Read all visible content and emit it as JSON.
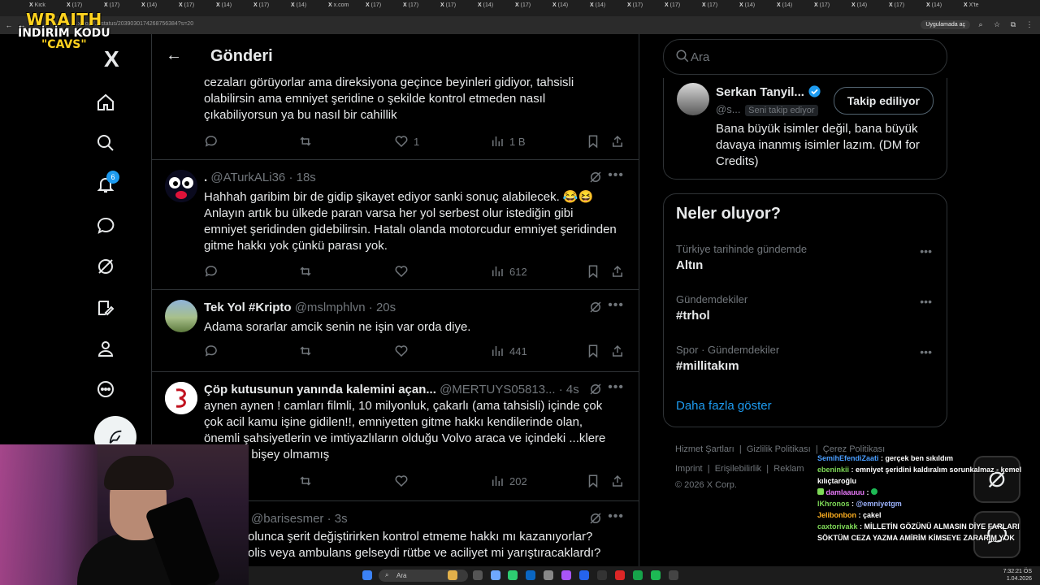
{
  "overlay": {
    "line1": "WRAITH",
    "line2": "İNDİRİM KODU",
    "line3": "\"CAVS\""
  },
  "browser": {
    "tabs": [
      "Kick",
      "(17)",
      "(17)",
      "(14)",
      "(17)",
      "(14)",
      "(17)",
      "(14)",
      "x.com",
      "(17)",
      "(17)",
      "(17)",
      "(14)",
      "(17)",
      "(14)",
      "(14)",
      "(17)",
      "(17)",
      "(17)",
      "(14)",
      "(14)",
      "(17)",
      "(14)",
      "(17)",
      "(14)",
      "X'te"
    ],
    "url": "...x.com/.../status/2039030174268756384?s=20",
    "right_pill": "Uygulamada aç"
  },
  "nav": {
    "logo": "X",
    "notifications_count": "6"
  },
  "header": {
    "back": "←",
    "title": "Gönderi"
  },
  "tweets": [
    {
      "partial": true,
      "body": "cezaları görüyorlar ama direksiyona geçince beyinleri gidiyor, tahsisli olabilirsin ama emniyet şeridine o şekilde kontrol etmeden nasıl çıkabiliyorsun ya bu nasıl bir cahillik",
      "likes": "1",
      "views": "1 B"
    },
    {
      "name": ".",
      "handle": "@ATurkALi36",
      "time": "18s",
      "body": "Hahhah garibim bir de gidip şikayet ediyor sanki sonuç alabilecek. 😂😆 Anlayın artık bu ülkede paran varsa her yol serbest olur istediğin gibi emniyet şeridinden gidebilirsin. Hatalı olanda motorcudur emniyet şeridinden gitme hakkı yok çünkü parası yok.",
      "views": "612"
    },
    {
      "name": "Tek Yol #Kripto",
      "handle": "@mslmphlvn",
      "time": "20s",
      "body": "Adama sorarlar amcik senin ne işin var orda diye.",
      "views": "441"
    },
    {
      "name": "Çöp kutusunun yanında kalemini açan...",
      "handle": "@MERTUYS05813...",
      "time": "4s",
      "body": "aynen aynen ! camları filmli, 10 milyonluk, çakarlı (ama tahsisli) içinde çok çok acil kamu işine gidilen!!, emniyetten gitme hakkı kendilerinde olan, önemli şahsiyetlerin ve imtiyazlıların olduğu Volvo araca ve içindeki ...klere Allahtan bişey olmamış",
      "views": "202"
    },
    {
      "handle": "@barisesmer",
      "time": "3s",
      "body": "olunca şerit değiştirirken kontrol etmeme hakkı mı kazanıyorlar? olis veya ambulans gelseydi rütbe ve aciliyet mi yarıştıracaklardı?"
    }
  ],
  "search": {
    "placeholder": "Ara"
  },
  "profile_card": {
    "name": "Serkan Tanyil...",
    "handle": "@s...",
    "follows_you": "Seni takip ediyor",
    "button": "Takip ediliyor",
    "bio": "Bana büyük isimler değil, bana büyük davaya inanmış isimler lazım. (DM for Credits)"
  },
  "trends": {
    "title": "Neler oluyor?",
    "items": [
      {
        "context": "Türkiye tarihinde gündemde",
        "name": "Altın"
      },
      {
        "context": "Gündemdekiler",
        "name": "#trhol"
      },
      {
        "context": "Spor · Gündemdekiler",
        "name": "#millitakım"
      }
    ],
    "show_more": "Daha fazla göster"
  },
  "footer": {
    "links1": [
      "Hizmet Şartları",
      "Gizlilik Politikası",
      "Çerez Politikası"
    ],
    "links2": [
      "Imprint",
      "Erişilebilirlik",
      "Reklam"
    ],
    "copyright": "© 2026 X Corp."
  },
  "chat": [
    {
      "user": "SemihEfendiZaati",
      "color": "#4a9eff",
      "msg": "gerçek ben sıkıldım"
    },
    {
      "user": "ebeninkii",
      "color": "#7ed957",
      "msg": "emniyet şeridini kaldıralım sorunkalmaz - kemel kılıçtaroğlu"
    },
    {
      "user": "damlaauuu",
      "color": "#e879f9",
      "msg": ""
    },
    {
      "user": "lKhronos",
      "color": "#7ed957",
      "msg": "@emniyetgm"
    },
    {
      "user": "Jelibonbon",
      "color": "#ffb020",
      "msg": "çakel"
    },
    {
      "user": "caxtorivakk",
      "color": "#7ed957",
      "msg": "MİLLETİN GÖZÜNÜ ALMASIN DİYE FARLARI SÖKTÜM CEZA YAZMA AMİRİM KİMSEYE ZARARIM YOK"
    }
  ],
  "taskbar": {
    "search": "Ara",
    "time": "7:32:21 ÖS",
    "date": "1.04.2026"
  },
  "colors": {
    "accent": "#1d9bf0",
    "bg": "#000000",
    "text": "#e7e9ea",
    "muted": "#71767b",
    "border": "#2f3336"
  }
}
